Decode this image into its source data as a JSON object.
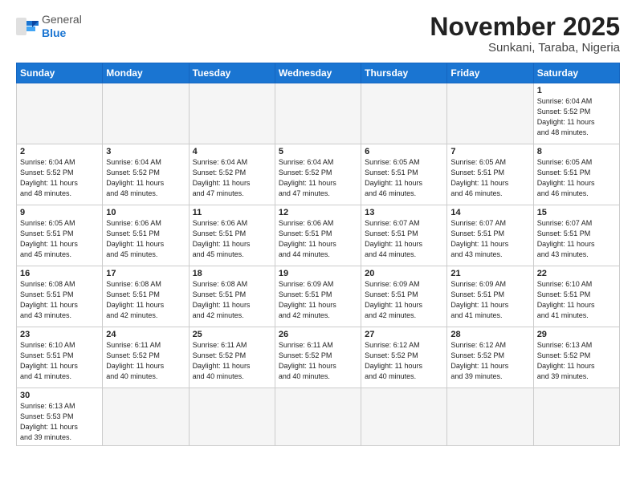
{
  "logo": {
    "general": "General",
    "blue": "Blue"
  },
  "title": "November 2025",
  "location": "Sunkani, Taraba, Nigeria",
  "weekdays": [
    "Sunday",
    "Monday",
    "Tuesday",
    "Wednesday",
    "Thursday",
    "Friday",
    "Saturday"
  ],
  "weeks": [
    [
      {
        "day": "",
        "text": ""
      },
      {
        "day": "",
        "text": ""
      },
      {
        "day": "",
        "text": ""
      },
      {
        "day": "",
        "text": ""
      },
      {
        "day": "",
        "text": ""
      },
      {
        "day": "",
        "text": ""
      },
      {
        "day": "1",
        "text": "Sunrise: 6:04 AM\nSunset: 5:52 PM\nDaylight: 11 hours\nand 48 minutes."
      }
    ],
    [
      {
        "day": "2",
        "text": "Sunrise: 6:04 AM\nSunset: 5:52 PM\nDaylight: 11 hours\nand 48 minutes."
      },
      {
        "day": "3",
        "text": "Sunrise: 6:04 AM\nSunset: 5:52 PM\nDaylight: 11 hours\nand 48 minutes."
      },
      {
        "day": "4",
        "text": "Sunrise: 6:04 AM\nSunset: 5:52 PM\nDaylight: 11 hours\nand 47 minutes."
      },
      {
        "day": "5",
        "text": "Sunrise: 6:04 AM\nSunset: 5:52 PM\nDaylight: 11 hours\nand 47 minutes."
      },
      {
        "day": "6",
        "text": "Sunrise: 6:05 AM\nSunset: 5:51 PM\nDaylight: 11 hours\nand 46 minutes."
      },
      {
        "day": "7",
        "text": "Sunrise: 6:05 AM\nSunset: 5:51 PM\nDaylight: 11 hours\nand 46 minutes."
      },
      {
        "day": "8",
        "text": "Sunrise: 6:05 AM\nSunset: 5:51 PM\nDaylight: 11 hours\nand 46 minutes."
      }
    ],
    [
      {
        "day": "9",
        "text": "Sunrise: 6:05 AM\nSunset: 5:51 PM\nDaylight: 11 hours\nand 45 minutes."
      },
      {
        "day": "10",
        "text": "Sunrise: 6:06 AM\nSunset: 5:51 PM\nDaylight: 11 hours\nand 45 minutes."
      },
      {
        "day": "11",
        "text": "Sunrise: 6:06 AM\nSunset: 5:51 PM\nDaylight: 11 hours\nand 45 minutes."
      },
      {
        "day": "12",
        "text": "Sunrise: 6:06 AM\nSunset: 5:51 PM\nDaylight: 11 hours\nand 44 minutes."
      },
      {
        "day": "13",
        "text": "Sunrise: 6:07 AM\nSunset: 5:51 PM\nDaylight: 11 hours\nand 44 minutes."
      },
      {
        "day": "14",
        "text": "Sunrise: 6:07 AM\nSunset: 5:51 PM\nDaylight: 11 hours\nand 43 minutes."
      },
      {
        "day": "15",
        "text": "Sunrise: 6:07 AM\nSunset: 5:51 PM\nDaylight: 11 hours\nand 43 minutes."
      }
    ],
    [
      {
        "day": "16",
        "text": "Sunrise: 6:08 AM\nSunset: 5:51 PM\nDaylight: 11 hours\nand 43 minutes."
      },
      {
        "day": "17",
        "text": "Sunrise: 6:08 AM\nSunset: 5:51 PM\nDaylight: 11 hours\nand 42 minutes."
      },
      {
        "day": "18",
        "text": "Sunrise: 6:08 AM\nSunset: 5:51 PM\nDaylight: 11 hours\nand 42 minutes."
      },
      {
        "day": "19",
        "text": "Sunrise: 6:09 AM\nSunset: 5:51 PM\nDaylight: 11 hours\nand 42 minutes."
      },
      {
        "day": "20",
        "text": "Sunrise: 6:09 AM\nSunset: 5:51 PM\nDaylight: 11 hours\nand 42 minutes."
      },
      {
        "day": "21",
        "text": "Sunrise: 6:09 AM\nSunset: 5:51 PM\nDaylight: 11 hours\nand 41 minutes."
      },
      {
        "day": "22",
        "text": "Sunrise: 6:10 AM\nSunset: 5:51 PM\nDaylight: 11 hours\nand 41 minutes."
      }
    ],
    [
      {
        "day": "23",
        "text": "Sunrise: 6:10 AM\nSunset: 5:51 PM\nDaylight: 11 hours\nand 41 minutes."
      },
      {
        "day": "24",
        "text": "Sunrise: 6:11 AM\nSunset: 5:52 PM\nDaylight: 11 hours\nand 40 minutes."
      },
      {
        "day": "25",
        "text": "Sunrise: 6:11 AM\nSunset: 5:52 PM\nDaylight: 11 hours\nand 40 minutes."
      },
      {
        "day": "26",
        "text": "Sunrise: 6:11 AM\nSunset: 5:52 PM\nDaylight: 11 hours\nand 40 minutes."
      },
      {
        "day": "27",
        "text": "Sunrise: 6:12 AM\nSunset: 5:52 PM\nDaylight: 11 hours\nand 40 minutes."
      },
      {
        "day": "28",
        "text": "Sunrise: 6:12 AM\nSunset: 5:52 PM\nDaylight: 11 hours\nand 39 minutes."
      },
      {
        "day": "29",
        "text": "Sunrise: 6:13 AM\nSunset: 5:52 PM\nDaylight: 11 hours\nand 39 minutes."
      }
    ],
    [
      {
        "day": "30",
        "text": "Sunrise: 6:13 AM\nSunset: 5:53 PM\nDaylight: 11 hours\nand 39 minutes."
      },
      {
        "day": "",
        "text": ""
      },
      {
        "day": "",
        "text": ""
      },
      {
        "day": "",
        "text": ""
      },
      {
        "day": "",
        "text": ""
      },
      {
        "day": "",
        "text": ""
      },
      {
        "day": "",
        "text": ""
      }
    ]
  ]
}
